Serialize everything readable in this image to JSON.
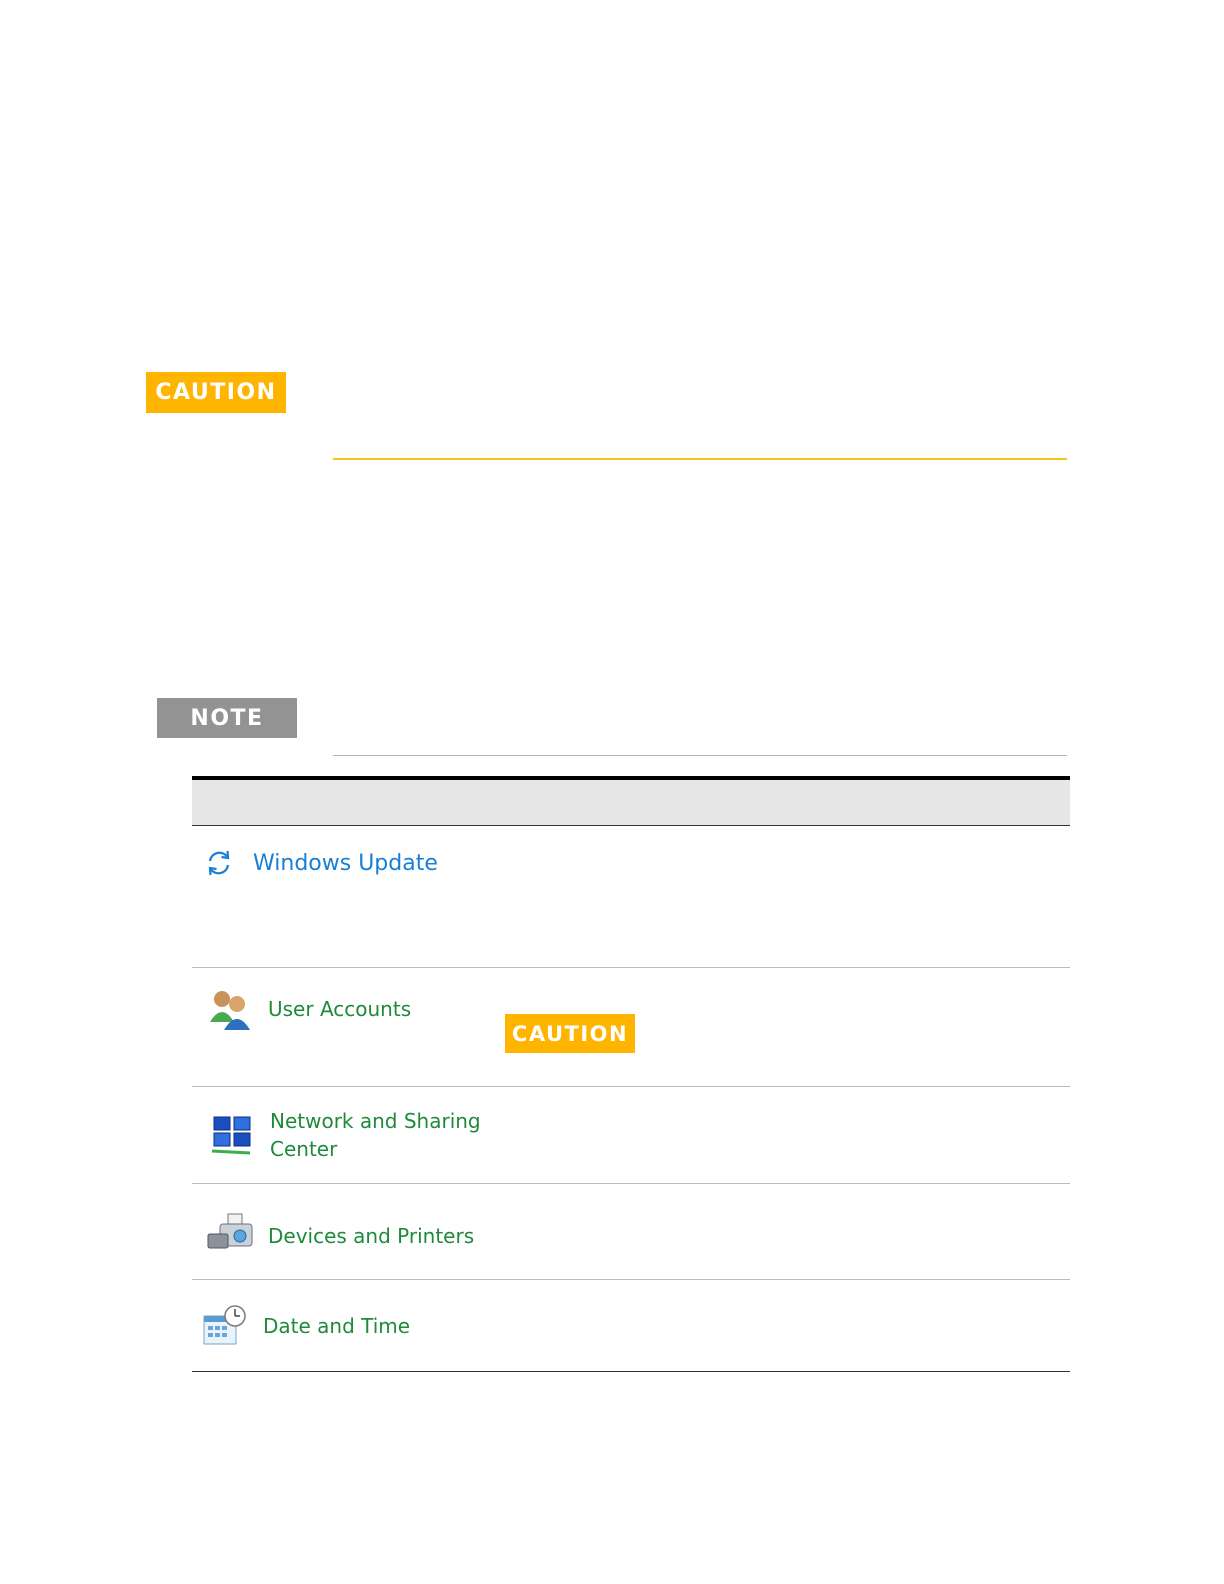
{
  "callouts": {
    "caution_top": "CAUTION",
    "note": "NOTE",
    "caution_inline": "CAUTION"
  },
  "colors": {
    "caution": "#FFB400",
    "note": "#939393",
    "link_blue": "#1a7fd4",
    "link_green": "#1f8a3a"
  },
  "table": {
    "rows": [
      {
        "label": "Windows Update",
        "icon": "refresh-icon"
      },
      {
        "label": "User Accounts",
        "icon": "user-accounts-icon"
      },
      {
        "label": "Network and Sharing\nCenter",
        "icon": "network-icon"
      },
      {
        "label": "Devices and Printers",
        "icon": "devices-printers-icon"
      },
      {
        "label": "Date and Time",
        "icon": "date-time-icon"
      }
    ]
  }
}
